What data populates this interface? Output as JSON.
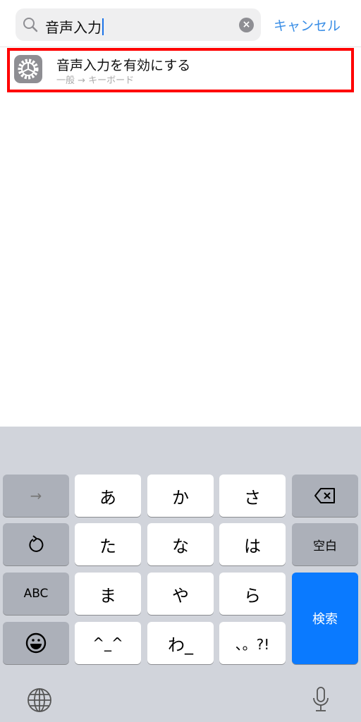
{
  "search": {
    "query": "音声入力",
    "clear_icon": "clear-icon",
    "cancel_label": "キャンセル"
  },
  "result": {
    "icon": "settings-gear-icon",
    "title": "音声入力を有効にする",
    "subtitle": "一般 → キーボード",
    "highlight_color": "#ff0000"
  },
  "keyboard": {
    "keys": {
      "next": "→",
      "a": "あ",
      "ka": "か",
      "sa": "さ",
      "undo": "undo-icon",
      "ta": "た",
      "na": "な",
      "ha": "は",
      "space": "空白",
      "abc": "ABC",
      "ma": "ま",
      "ya": "や",
      "ra": "ら",
      "search": "検索",
      "emoji": "emoji-icon",
      "kaomoji": "^_^",
      "wa": "わ_",
      "punct": "、。?!",
      "delete": "delete-icon"
    },
    "accent": "#0a7aff"
  }
}
